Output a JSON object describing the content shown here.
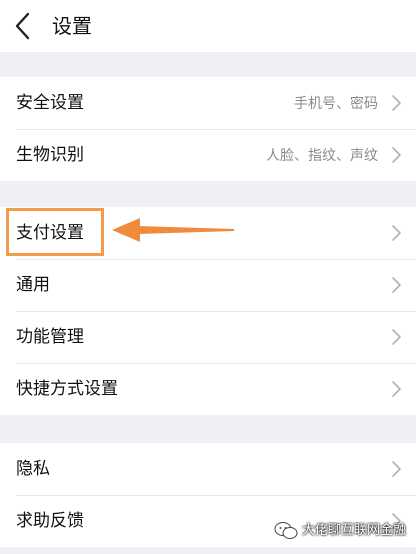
{
  "header": {
    "title": "设置",
    "back_icon": "chevron-left-icon"
  },
  "groups": [
    {
      "items": [
        {
          "label": "安全设置",
          "value": "手机号、密码"
        },
        {
          "label": "生物识别",
          "value": "人脸、指纹、声纹"
        }
      ]
    },
    {
      "items": [
        {
          "label": "支付设置",
          "value": ""
        },
        {
          "label": "通用",
          "value": ""
        },
        {
          "label": "功能管理",
          "value": ""
        },
        {
          "label": "快捷方式设置",
          "value": ""
        }
      ]
    },
    {
      "items": [
        {
          "label": "隐私",
          "value": ""
        },
        {
          "label": "求助反馈",
          "value": ""
        }
      ]
    }
  ],
  "annotation": {
    "highlight_color": "#f39a4c",
    "highlighted_item": "支付设置"
  },
  "watermark": {
    "text": "大佬聊互联网金融",
    "icon": "wechat-official-account-icon"
  }
}
